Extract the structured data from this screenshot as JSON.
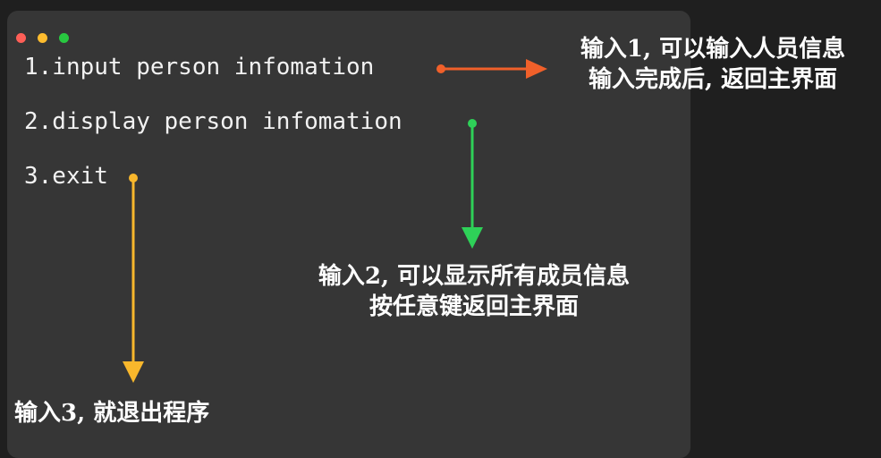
{
  "window": {
    "buttons": [
      {
        "name": "close",
        "color": "#ff5f57"
      },
      {
        "name": "minimize",
        "color": "#febc2e"
      },
      {
        "name": "zoom",
        "color": "#28c840"
      }
    ]
  },
  "menu": {
    "items": [
      {
        "label": "1.input person infomation"
      },
      {
        "label": "2.display person infomation"
      },
      {
        "label": "3.exit"
      }
    ]
  },
  "notes": {
    "input": {
      "line1": "输入1, 可以输入人员信息",
      "line2": "输入完成后, 返回主界面",
      "color": "#f0602a"
    },
    "display": {
      "line1": "输入2, 可以显示所有成员信息",
      "line2": "按任意键返回主界面",
      "color": "#2ed158"
    },
    "exit": {
      "line1": "输入3, 就退出程序",
      "color": "#f8b72c"
    }
  }
}
